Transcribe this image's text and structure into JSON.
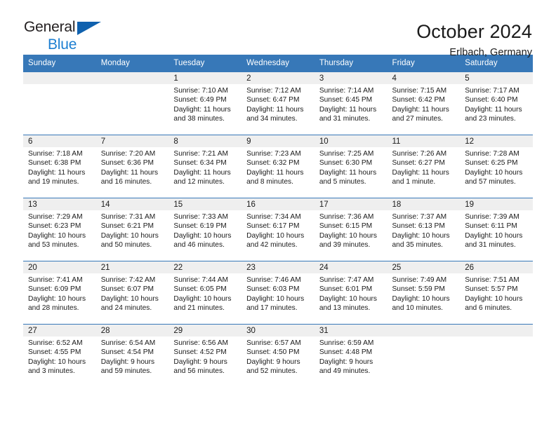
{
  "brand": {
    "name_part1": "General",
    "name_part2": "Blue",
    "triangle_color": "#1061ae",
    "blue_color": "#1d7fd1"
  },
  "header": {
    "title": "October 2024",
    "subtitle": "Erlbach, Germany"
  },
  "colors": {
    "header_bg": "#3778b8",
    "header_text": "#ffffff",
    "daynum_band": "#efefef",
    "cell_bg": "#ffffff",
    "text": "#1a1a1a"
  },
  "calendar": {
    "weekday_headers": [
      "Sunday",
      "Monday",
      "Tuesday",
      "Wednesday",
      "Thursday",
      "Friday",
      "Saturday"
    ],
    "labels": {
      "sunrise": "Sunrise:",
      "sunset": "Sunset:",
      "daylight": "Daylight:"
    },
    "weeks": [
      [
        {
          "day": "",
          "sunrise": "",
          "sunset": "",
          "daylight_line1": "",
          "daylight_line2": "",
          "empty": true
        },
        {
          "day": "",
          "sunrise": "",
          "sunset": "",
          "daylight_line1": "",
          "daylight_line2": "",
          "empty": true
        },
        {
          "day": "1",
          "sunrise": "Sunrise: 7:10 AM",
          "sunset": "Sunset: 6:49 PM",
          "daylight_line1": "Daylight: 11 hours",
          "daylight_line2": "and 38 minutes."
        },
        {
          "day": "2",
          "sunrise": "Sunrise: 7:12 AM",
          "sunset": "Sunset: 6:47 PM",
          "daylight_line1": "Daylight: 11 hours",
          "daylight_line2": "and 34 minutes."
        },
        {
          "day": "3",
          "sunrise": "Sunrise: 7:14 AM",
          "sunset": "Sunset: 6:45 PM",
          "daylight_line1": "Daylight: 11 hours",
          "daylight_line2": "and 31 minutes."
        },
        {
          "day": "4",
          "sunrise": "Sunrise: 7:15 AM",
          "sunset": "Sunset: 6:42 PM",
          "daylight_line1": "Daylight: 11 hours",
          "daylight_line2": "and 27 minutes."
        },
        {
          "day": "5",
          "sunrise": "Sunrise: 7:17 AM",
          "sunset": "Sunset: 6:40 PM",
          "daylight_line1": "Daylight: 11 hours",
          "daylight_line2": "and 23 minutes."
        }
      ],
      [
        {
          "day": "6",
          "sunrise": "Sunrise: 7:18 AM",
          "sunset": "Sunset: 6:38 PM",
          "daylight_line1": "Daylight: 11 hours",
          "daylight_line2": "and 19 minutes."
        },
        {
          "day": "7",
          "sunrise": "Sunrise: 7:20 AM",
          "sunset": "Sunset: 6:36 PM",
          "daylight_line1": "Daylight: 11 hours",
          "daylight_line2": "and 16 minutes."
        },
        {
          "day": "8",
          "sunrise": "Sunrise: 7:21 AM",
          "sunset": "Sunset: 6:34 PM",
          "daylight_line1": "Daylight: 11 hours",
          "daylight_line2": "and 12 minutes."
        },
        {
          "day": "9",
          "sunrise": "Sunrise: 7:23 AM",
          "sunset": "Sunset: 6:32 PM",
          "daylight_line1": "Daylight: 11 hours",
          "daylight_line2": "and 8 minutes."
        },
        {
          "day": "10",
          "sunrise": "Sunrise: 7:25 AM",
          "sunset": "Sunset: 6:30 PM",
          "daylight_line1": "Daylight: 11 hours",
          "daylight_line2": "and 5 minutes."
        },
        {
          "day": "11",
          "sunrise": "Sunrise: 7:26 AM",
          "sunset": "Sunset: 6:27 PM",
          "daylight_line1": "Daylight: 11 hours",
          "daylight_line2": "and 1 minute."
        },
        {
          "day": "12",
          "sunrise": "Sunrise: 7:28 AM",
          "sunset": "Sunset: 6:25 PM",
          "daylight_line1": "Daylight: 10 hours",
          "daylight_line2": "and 57 minutes."
        }
      ],
      [
        {
          "day": "13",
          "sunrise": "Sunrise: 7:29 AM",
          "sunset": "Sunset: 6:23 PM",
          "daylight_line1": "Daylight: 10 hours",
          "daylight_line2": "and 53 minutes."
        },
        {
          "day": "14",
          "sunrise": "Sunrise: 7:31 AM",
          "sunset": "Sunset: 6:21 PM",
          "daylight_line1": "Daylight: 10 hours",
          "daylight_line2": "and 50 minutes."
        },
        {
          "day": "15",
          "sunrise": "Sunrise: 7:33 AM",
          "sunset": "Sunset: 6:19 PM",
          "daylight_line1": "Daylight: 10 hours",
          "daylight_line2": "and 46 minutes."
        },
        {
          "day": "16",
          "sunrise": "Sunrise: 7:34 AM",
          "sunset": "Sunset: 6:17 PM",
          "daylight_line1": "Daylight: 10 hours",
          "daylight_line2": "and 42 minutes."
        },
        {
          "day": "17",
          "sunrise": "Sunrise: 7:36 AM",
          "sunset": "Sunset: 6:15 PM",
          "daylight_line1": "Daylight: 10 hours",
          "daylight_line2": "and 39 minutes."
        },
        {
          "day": "18",
          "sunrise": "Sunrise: 7:37 AM",
          "sunset": "Sunset: 6:13 PM",
          "daylight_line1": "Daylight: 10 hours",
          "daylight_line2": "and 35 minutes."
        },
        {
          "day": "19",
          "sunrise": "Sunrise: 7:39 AM",
          "sunset": "Sunset: 6:11 PM",
          "daylight_line1": "Daylight: 10 hours",
          "daylight_line2": "and 31 minutes."
        }
      ],
      [
        {
          "day": "20",
          "sunrise": "Sunrise: 7:41 AM",
          "sunset": "Sunset: 6:09 PM",
          "daylight_line1": "Daylight: 10 hours",
          "daylight_line2": "and 28 minutes."
        },
        {
          "day": "21",
          "sunrise": "Sunrise: 7:42 AM",
          "sunset": "Sunset: 6:07 PM",
          "daylight_line1": "Daylight: 10 hours",
          "daylight_line2": "and 24 minutes."
        },
        {
          "day": "22",
          "sunrise": "Sunrise: 7:44 AM",
          "sunset": "Sunset: 6:05 PM",
          "daylight_line1": "Daylight: 10 hours",
          "daylight_line2": "and 21 minutes."
        },
        {
          "day": "23",
          "sunrise": "Sunrise: 7:46 AM",
          "sunset": "Sunset: 6:03 PM",
          "daylight_line1": "Daylight: 10 hours",
          "daylight_line2": "and 17 minutes."
        },
        {
          "day": "24",
          "sunrise": "Sunrise: 7:47 AM",
          "sunset": "Sunset: 6:01 PM",
          "daylight_line1": "Daylight: 10 hours",
          "daylight_line2": "and 13 minutes."
        },
        {
          "day": "25",
          "sunrise": "Sunrise: 7:49 AM",
          "sunset": "Sunset: 5:59 PM",
          "daylight_line1": "Daylight: 10 hours",
          "daylight_line2": "and 10 minutes."
        },
        {
          "day": "26",
          "sunrise": "Sunrise: 7:51 AM",
          "sunset": "Sunset: 5:57 PM",
          "daylight_line1": "Daylight: 10 hours",
          "daylight_line2": "and 6 minutes."
        }
      ],
      [
        {
          "day": "27",
          "sunrise": "Sunrise: 6:52 AM",
          "sunset": "Sunset: 4:55 PM",
          "daylight_line1": "Daylight: 10 hours",
          "daylight_line2": "and 3 minutes."
        },
        {
          "day": "28",
          "sunrise": "Sunrise: 6:54 AM",
          "sunset": "Sunset: 4:54 PM",
          "daylight_line1": "Daylight: 9 hours",
          "daylight_line2": "and 59 minutes."
        },
        {
          "day": "29",
          "sunrise": "Sunrise: 6:56 AM",
          "sunset": "Sunset: 4:52 PM",
          "daylight_line1": "Daylight: 9 hours",
          "daylight_line2": "and 56 minutes."
        },
        {
          "day": "30",
          "sunrise": "Sunrise: 6:57 AM",
          "sunset": "Sunset: 4:50 PM",
          "daylight_line1": "Daylight: 9 hours",
          "daylight_line2": "and 52 minutes."
        },
        {
          "day": "31",
          "sunrise": "Sunrise: 6:59 AM",
          "sunset": "Sunset: 4:48 PM",
          "daylight_line1": "Daylight: 9 hours",
          "daylight_line2": "and 49 minutes."
        },
        {
          "day": "",
          "sunrise": "",
          "sunset": "",
          "daylight_line1": "",
          "daylight_line2": "",
          "empty": true
        },
        {
          "day": "",
          "sunrise": "",
          "sunset": "",
          "daylight_line1": "",
          "daylight_line2": "",
          "empty": true
        }
      ]
    ]
  }
}
